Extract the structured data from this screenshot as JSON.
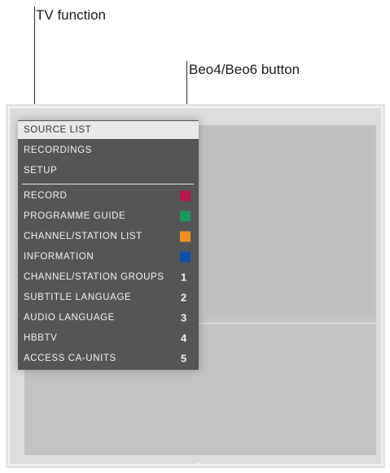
{
  "callouts": {
    "tv_function": "TV function",
    "beo_button": "Beo4/Beo6 button"
  },
  "menu": {
    "items": [
      {
        "label": "SOURCE LIST",
        "selected": true
      },
      {
        "label": "RECORDINGS"
      },
      {
        "label": "SETUP"
      },
      {
        "label": "RECORD",
        "key_color": "#b3174d"
      },
      {
        "label": "PROGRAMME GUIDE",
        "key_color": "#1a9a5b"
      },
      {
        "label": "CHANNEL/STATION LIST",
        "key_color": "#f28c28"
      },
      {
        "label": "INFORMATION",
        "key_color": "#0d4fa8"
      },
      {
        "label": "CHANNEL/STATION GROUPS",
        "key": "1"
      },
      {
        "label": "SUBTITLE LANGUAGE",
        "key": "2"
      },
      {
        "label": "AUDIO LANGUAGE",
        "key": "3"
      },
      {
        "label": "HBBTV",
        "key": "4"
      },
      {
        "label": "ACCESS CA-UNITS",
        "key": "5"
      }
    ]
  }
}
